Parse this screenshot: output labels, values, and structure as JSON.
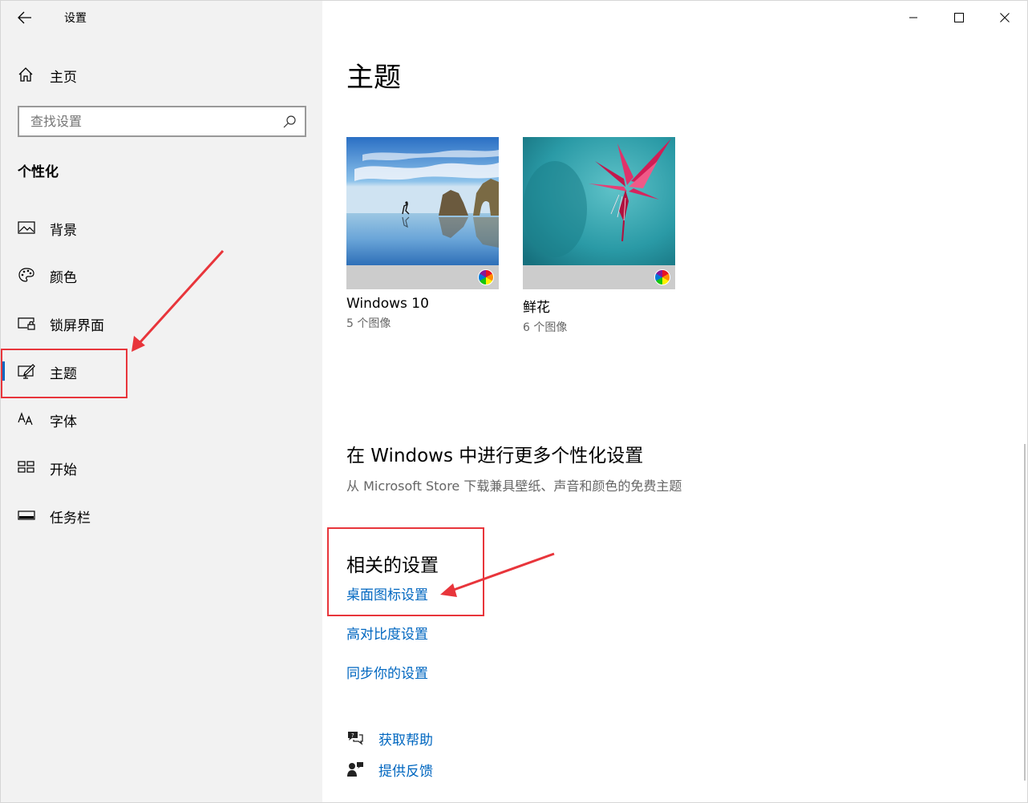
{
  "sidebar": {
    "app_title": "设置",
    "home_label": "主页",
    "search_placeholder": "查找设置",
    "section_title": "个性化",
    "items": [
      {
        "label": "背景",
        "icon": "picture-icon"
      },
      {
        "label": "颜色",
        "icon": "palette-icon"
      },
      {
        "label": "锁屏界面",
        "icon": "lock-screen-icon"
      },
      {
        "label": "主题",
        "icon": "theme-icon",
        "active": true
      },
      {
        "label": "字体",
        "icon": "font-icon"
      },
      {
        "label": "开始",
        "icon": "start-icon"
      },
      {
        "label": "任务栏",
        "icon": "taskbar-icon"
      }
    ]
  },
  "main": {
    "title": "主题",
    "themes": [
      {
        "name": "Windows 10",
        "count": "5 个图像"
      },
      {
        "name": "鲜花",
        "count": "6 个图像"
      }
    ],
    "more": {
      "title": "在 Windows 中进行更多个性化设置",
      "description": "从 Microsoft Store 下载兼具壁纸、声音和颜色的免费主题"
    },
    "related": {
      "title": "相关的设置",
      "links": [
        "桌面图标设置",
        "高对比度设置",
        "同步你的设置"
      ]
    },
    "help": {
      "get_help": "获取帮助",
      "feedback": "提供反馈"
    }
  },
  "colors": {
    "accent": "#0067c0",
    "sidebar_bg": "#f2f2f2",
    "annotation": "#e8353b"
  }
}
